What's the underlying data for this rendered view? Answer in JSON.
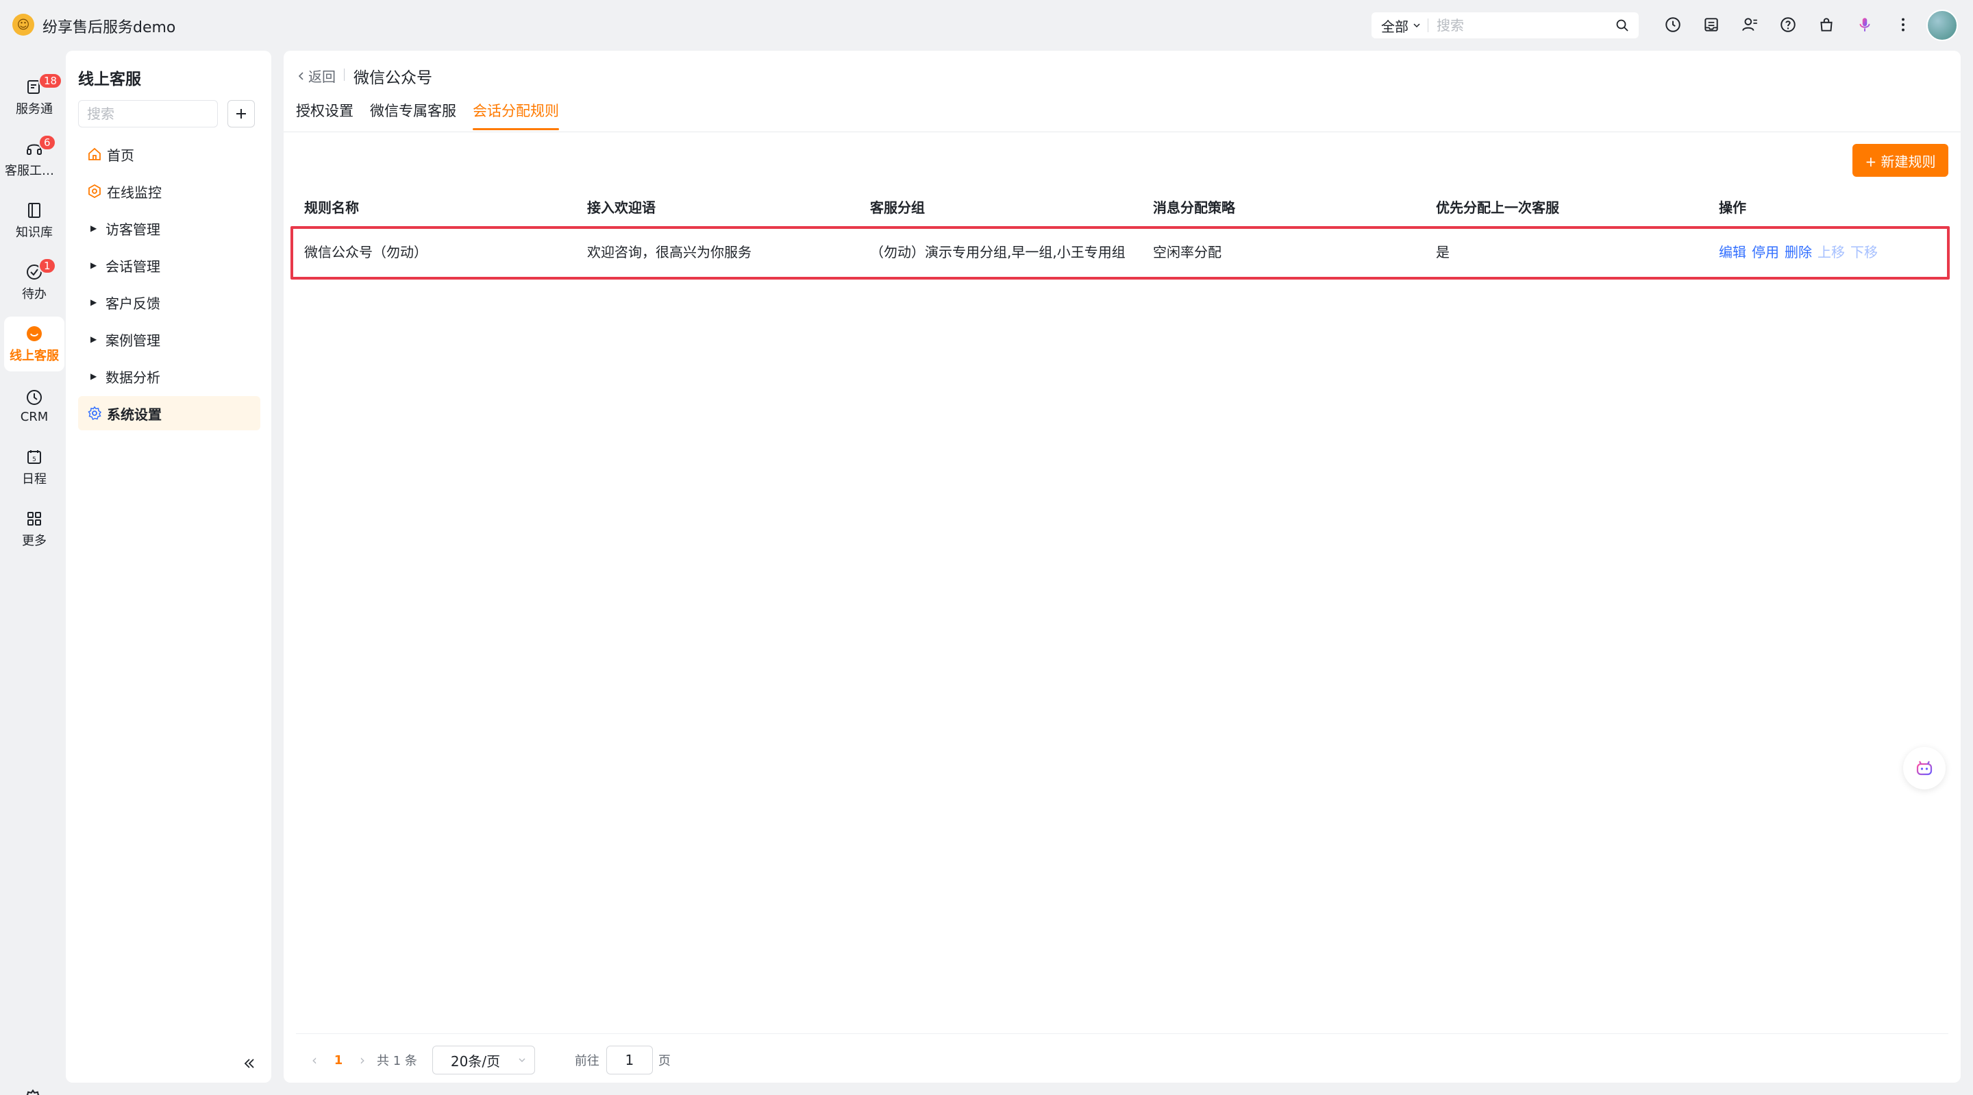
{
  "app": {
    "title": "纷享售后服务demo",
    "logo_icon": "mascot-logo-icon"
  },
  "topbar": {
    "search_scope": "全部",
    "search_placeholder": "搜索",
    "icons": [
      "clock-icon",
      "inbox-icon",
      "contacts-icon",
      "help-icon",
      "bag-icon",
      "microphone-icon",
      "more-vertical-icon"
    ]
  },
  "rail": {
    "items": [
      {
        "label": "服务通",
        "icon": "service-icon",
        "badge": "18"
      },
      {
        "label": "客服工作台",
        "icon": "headset-icon",
        "badge": "6"
      },
      {
        "label": "知识库",
        "icon": "book-icon",
        "badge": ""
      },
      {
        "label": "待办",
        "icon": "check-circle-icon",
        "badge": "1"
      },
      {
        "label": "线上客服",
        "icon": "online-service-icon",
        "badge": "",
        "active": true
      },
      {
        "label": "CRM",
        "icon": "crm-icon",
        "badge": ""
      },
      {
        "label": "日程",
        "icon": "calendar-icon",
        "badge": ""
      },
      {
        "label": "更多",
        "icon": "grid-icon",
        "badge": ""
      }
    ]
  },
  "panel": {
    "title": "线上客服",
    "search_placeholder": "搜索",
    "nav": [
      {
        "label": "首页",
        "type": "icon",
        "icon": "home-icon"
      },
      {
        "label": "在线监控",
        "type": "icon",
        "icon": "monitor-icon"
      },
      {
        "label": "访客管理",
        "type": "caret"
      },
      {
        "label": "会话管理",
        "type": "caret"
      },
      {
        "label": "客户反馈",
        "type": "caret"
      },
      {
        "label": "案例管理",
        "type": "caret"
      },
      {
        "label": "数据分析",
        "type": "caret"
      },
      {
        "label": "系统设置",
        "type": "icon",
        "icon": "settings-icon",
        "active": true
      }
    ]
  },
  "main": {
    "back_label": "返回",
    "page_title": "微信公众号",
    "tabs": [
      {
        "label": "授权设置"
      },
      {
        "label": "微信专属客服"
      },
      {
        "label": "会话分配规则",
        "active": true
      }
    ],
    "new_button": "+ 新建规则",
    "table": {
      "headers": [
        "规则名称",
        "接入欢迎语",
        "客服分组",
        "消息分配策略",
        "优先分配上一次客服",
        "操作"
      ],
      "rows": [
        {
          "name": "微信公众号（勿动）",
          "welcome": "欢迎咨询，很高兴为你服务",
          "group": "（勿动）演示专用分组,早一组,小王专用组",
          "strategy": "空闲率分配",
          "priority": "是",
          "ops": [
            "编辑",
            "停用",
            "删除",
            "上移",
            "下移"
          ]
        }
      ]
    },
    "pager": {
      "current": "1",
      "total": "共 1 条",
      "page_size": "20条/页",
      "goto_label": "前往",
      "goto_value": "1",
      "unit": "页"
    }
  },
  "colors": {
    "accent": "#ff7a00",
    "link": "#3370ff",
    "highlight": "#e8394a"
  }
}
